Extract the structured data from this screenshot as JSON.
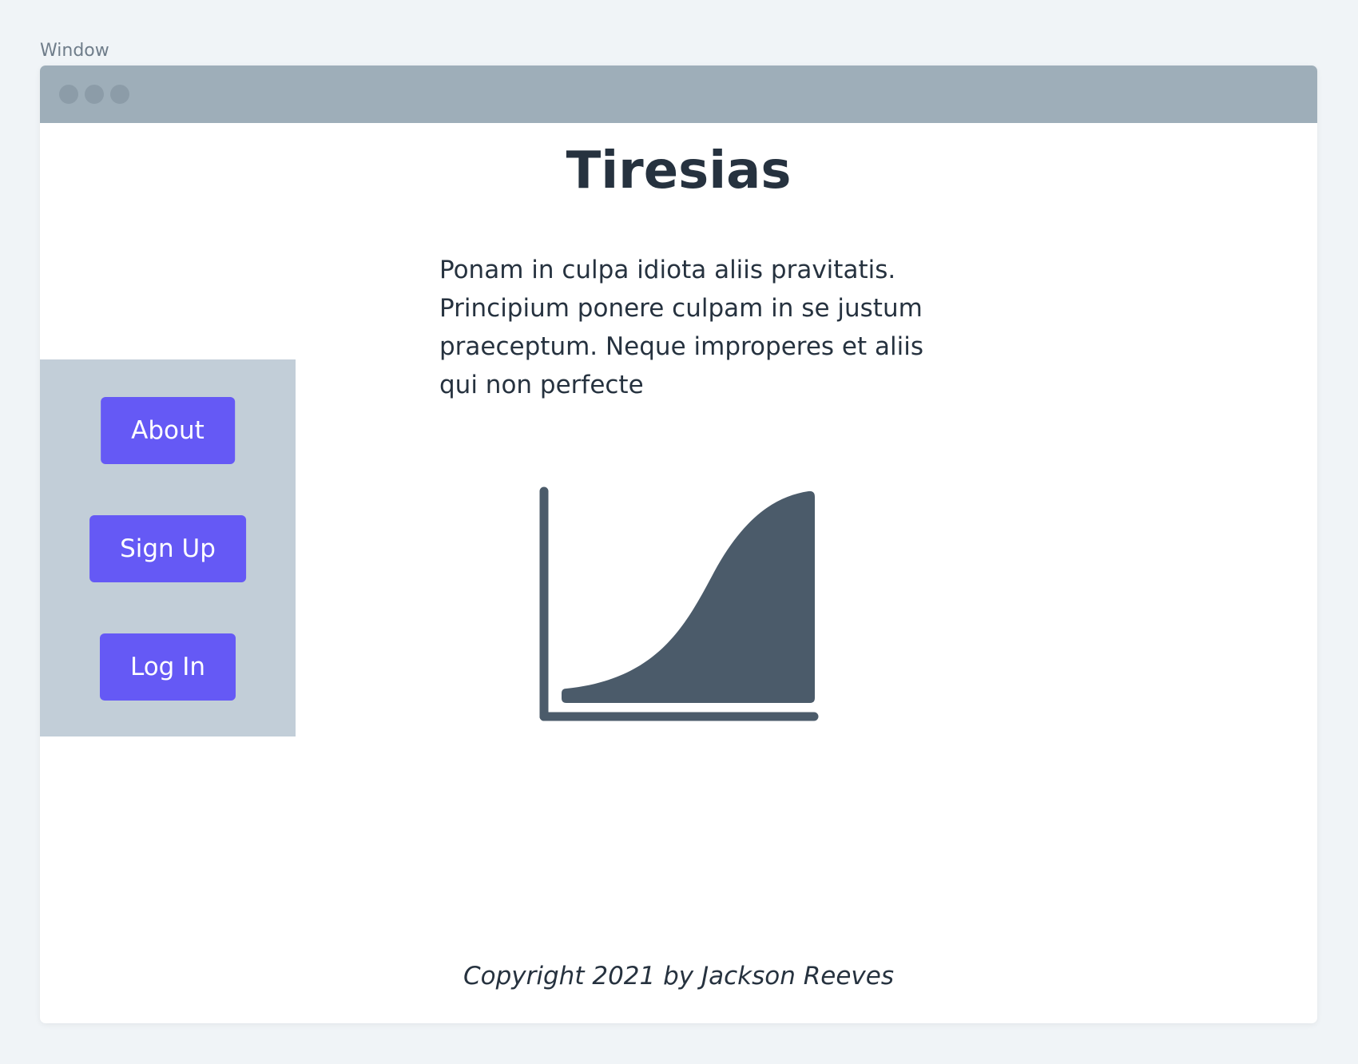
{
  "window": {
    "label": "Window"
  },
  "page": {
    "title": "Tiresias",
    "body": "Ponam in culpa idiota aliis pravitatis. Principium ponere culpam in se justum praeceptum. Neque improperes et aliis qui non perfecte",
    "footer": "Copyright 2021 by Jackson Reeves"
  },
  "sidebar": {
    "items": [
      {
        "label": "About"
      },
      {
        "label": "Sign Up"
      },
      {
        "label": "Log In"
      }
    ]
  },
  "icons": {
    "chart": "area-chart-icon",
    "window_controls": [
      "window-dot-icon",
      "window-dot-icon",
      "window-dot-icon"
    ]
  },
  "colors": {
    "page_background": "#f0f4f7",
    "titlebar": "#9eaeb9",
    "window_dot": "#8c9ca8",
    "sidebar": "#c2ced8",
    "button": "#6559f5",
    "button_text": "#ffffff",
    "text": "#26323f",
    "chart_icon": "#4b5b6a"
  }
}
